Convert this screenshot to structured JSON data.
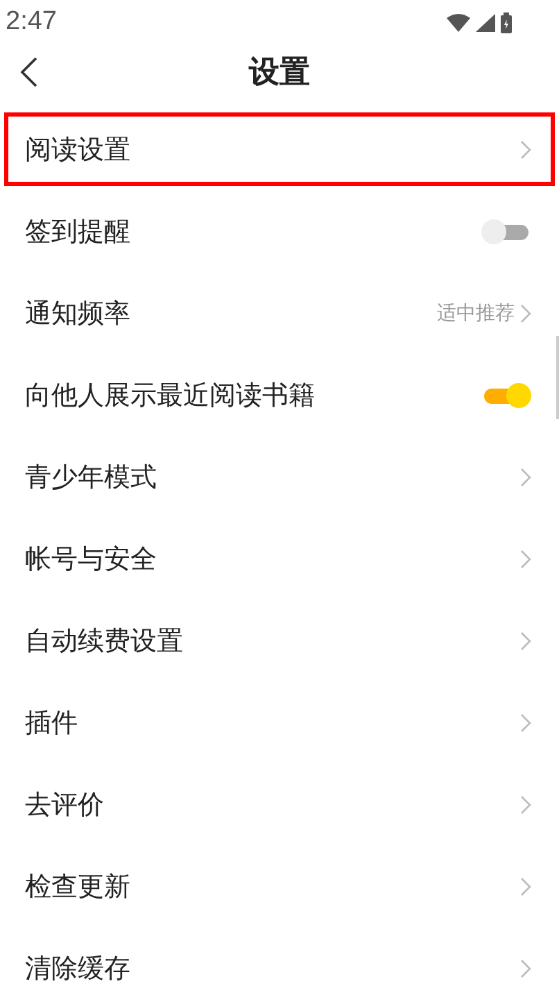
{
  "status_bar": {
    "time": "2:47"
  },
  "header": {
    "title": "设置"
  },
  "rows": [
    {
      "label": "阅读设置",
      "kind": "link",
      "highlighted": true
    },
    {
      "label": "签到提醒",
      "kind": "toggle",
      "on": false,
      "highlighted": false
    },
    {
      "label": "通知频率",
      "kind": "value",
      "value": "适中推荐",
      "highlighted": false
    },
    {
      "label": "向他人展示最近阅读书籍",
      "kind": "toggle",
      "on": true,
      "highlighted": false
    },
    {
      "label": "青少年模式",
      "kind": "link",
      "highlighted": false
    },
    {
      "label": "帐号与安全",
      "kind": "link",
      "highlighted": false
    },
    {
      "label": "自动续费设置",
      "kind": "link",
      "highlighted": false
    },
    {
      "label": "插件",
      "kind": "link",
      "highlighted": false
    },
    {
      "label": "去评价",
      "kind": "link",
      "highlighted": false
    },
    {
      "label": "检查更新",
      "kind": "link",
      "highlighted": false
    },
    {
      "label": "清除缓存",
      "kind": "link",
      "highlighted": false
    }
  ]
}
